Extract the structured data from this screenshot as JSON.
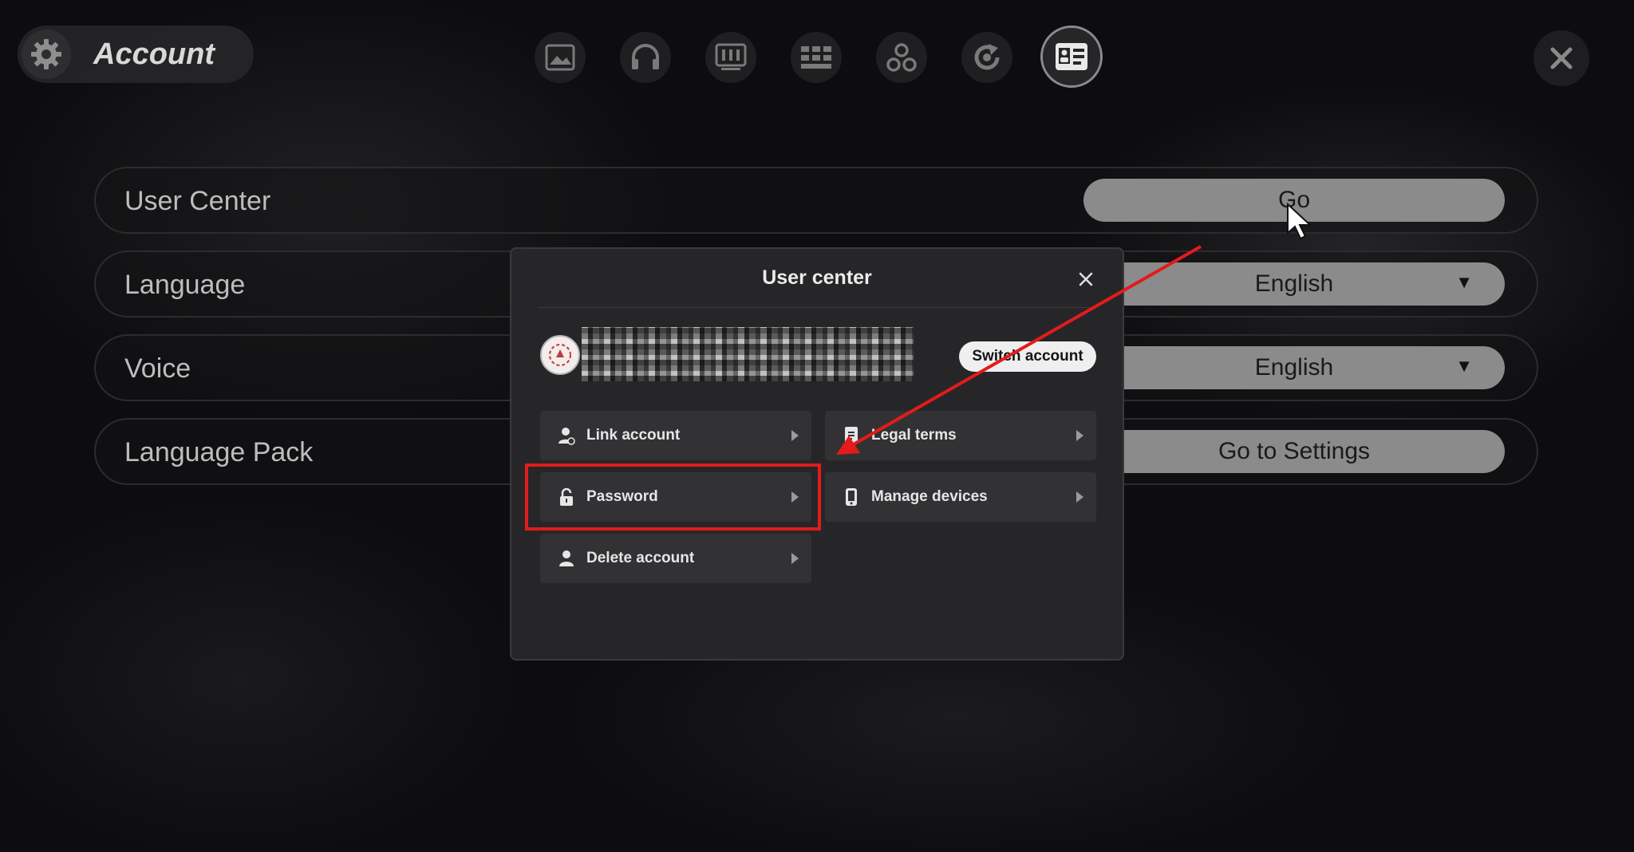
{
  "header": {
    "title": "Account",
    "tabs": [
      "image-tab-icon",
      "headphones-tab-icon",
      "controller-tab-icon",
      "keyboard-tab-icon",
      "nodes-tab-icon",
      "refresh-tab-icon",
      "account-card-tab-icon"
    ],
    "active_tab": "account-card-tab-icon"
  },
  "settings": {
    "rows": [
      {
        "label": "User Center",
        "button": "Go",
        "dropdown": false
      },
      {
        "label": "Language",
        "button": "English",
        "dropdown": true
      },
      {
        "label": "Voice",
        "button": "English",
        "dropdown": true
      },
      {
        "label": "Language Pack",
        "button": "Go to Settings",
        "dropdown": false
      }
    ]
  },
  "modal": {
    "title": "User center",
    "switch_account_label": "Switch account",
    "options": [
      {
        "label": "Link account",
        "icon": "user-link-icon"
      },
      {
        "label": "Legal terms",
        "icon": "document-icon"
      },
      {
        "label": "Password",
        "icon": "lock-icon"
      },
      {
        "label": "Manage devices",
        "icon": "phone-icon"
      },
      {
        "label": "Delete account",
        "icon": "user-icon"
      }
    ]
  },
  "annotation": {
    "highlight_color": "#e31b1b",
    "highlighted_option": "Password"
  }
}
